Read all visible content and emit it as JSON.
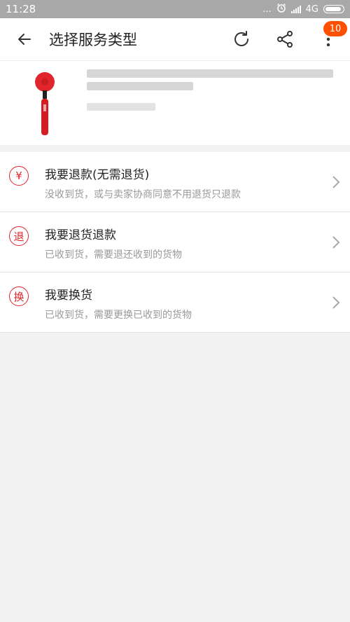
{
  "status_bar": {
    "time": "11:28",
    "network": "4G",
    "dots": "..."
  },
  "header": {
    "title": "选择服务类型",
    "badge": "10"
  },
  "options": [
    {
      "icon_text": "¥",
      "title": "我要退款(无需退货)",
      "subtitle": "没收到货，或与卖家协商同意不用退货只退款"
    },
    {
      "icon_text": "退",
      "title": "我要退货退款",
      "subtitle": "已收到货，需要退还收到的货物"
    },
    {
      "icon_text": "换",
      "title": "我要换货",
      "subtitle": "已收到货，需要更换已收到的货物"
    }
  ],
  "colors": {
    "accent": "#e0262b",
    "badge": "#ff5000"
  }
}
